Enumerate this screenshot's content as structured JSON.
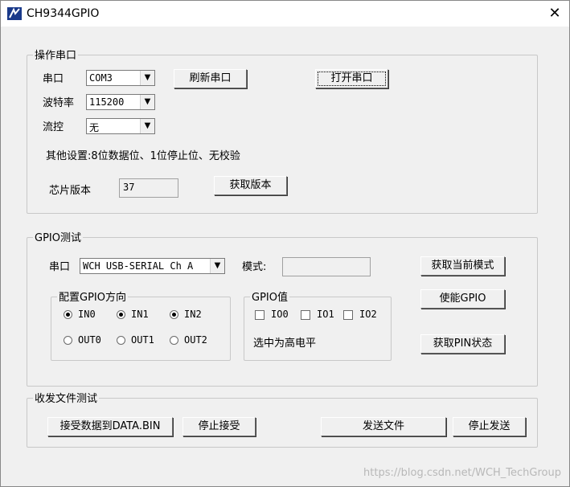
{
  "window": {
    "title": "CH9344GPIO",
    "close_glyph": "✕"
  },
  "serial_group": {
    "title": "操作串口",
    "port_label": "串口",
    "port_value": "COM3",
    "baud_label": "波特率",
    "baud_value": "115200",
    "flow_label": "流控",
    "flow_value": "无",
    "refresh_button": "刷新串口",
    "open_button": "打开串口",
    "other_settings": "其他设置:8位数据位、1位停止位、无校验",
    "chip_version_label": "芯片版本",
    "chip_version_value": "37",
    "get_version_button": "获取版本"
  },
  "gpio_group": {
    "title": "GPIO测试",
    "port_label": "串口",
    "port_value": "WCH USB-SERIAL Ch A",
    "mode_label": "模式:",
    "mode_value": "",
    "get_mode_button": "获取当前模式",
    "enable_button": "使能GPIO",
    "get_pin_button": "获取PIN状态",
    "direction": {
      "title": "配置GPIO方向",
      "in0": "IN0",
      "in1": "IN1",
      "in2": "IN2",
      "out0": "OUT0",
      "out1": "OUT1",
      "out2": "OUT2"
    },
    "value": {
      "title": "GPIO值",
      "io0": "IO0",
      "io1": "IO1",
      "io2": "IO2",
      "note": "选中为高电平"
    }
  },
  "file_group": {
    "title": "收发文件测试",
    "receive_button": "接受数据到DATA.BIN",
    "stop_receive_button": "停止接受",
    "send_button": "发送文件",
    "stop_send_button": "停止发送"
  },
  "watermark": "https://blog.csdn.net/WCH_TechGroup"
}
